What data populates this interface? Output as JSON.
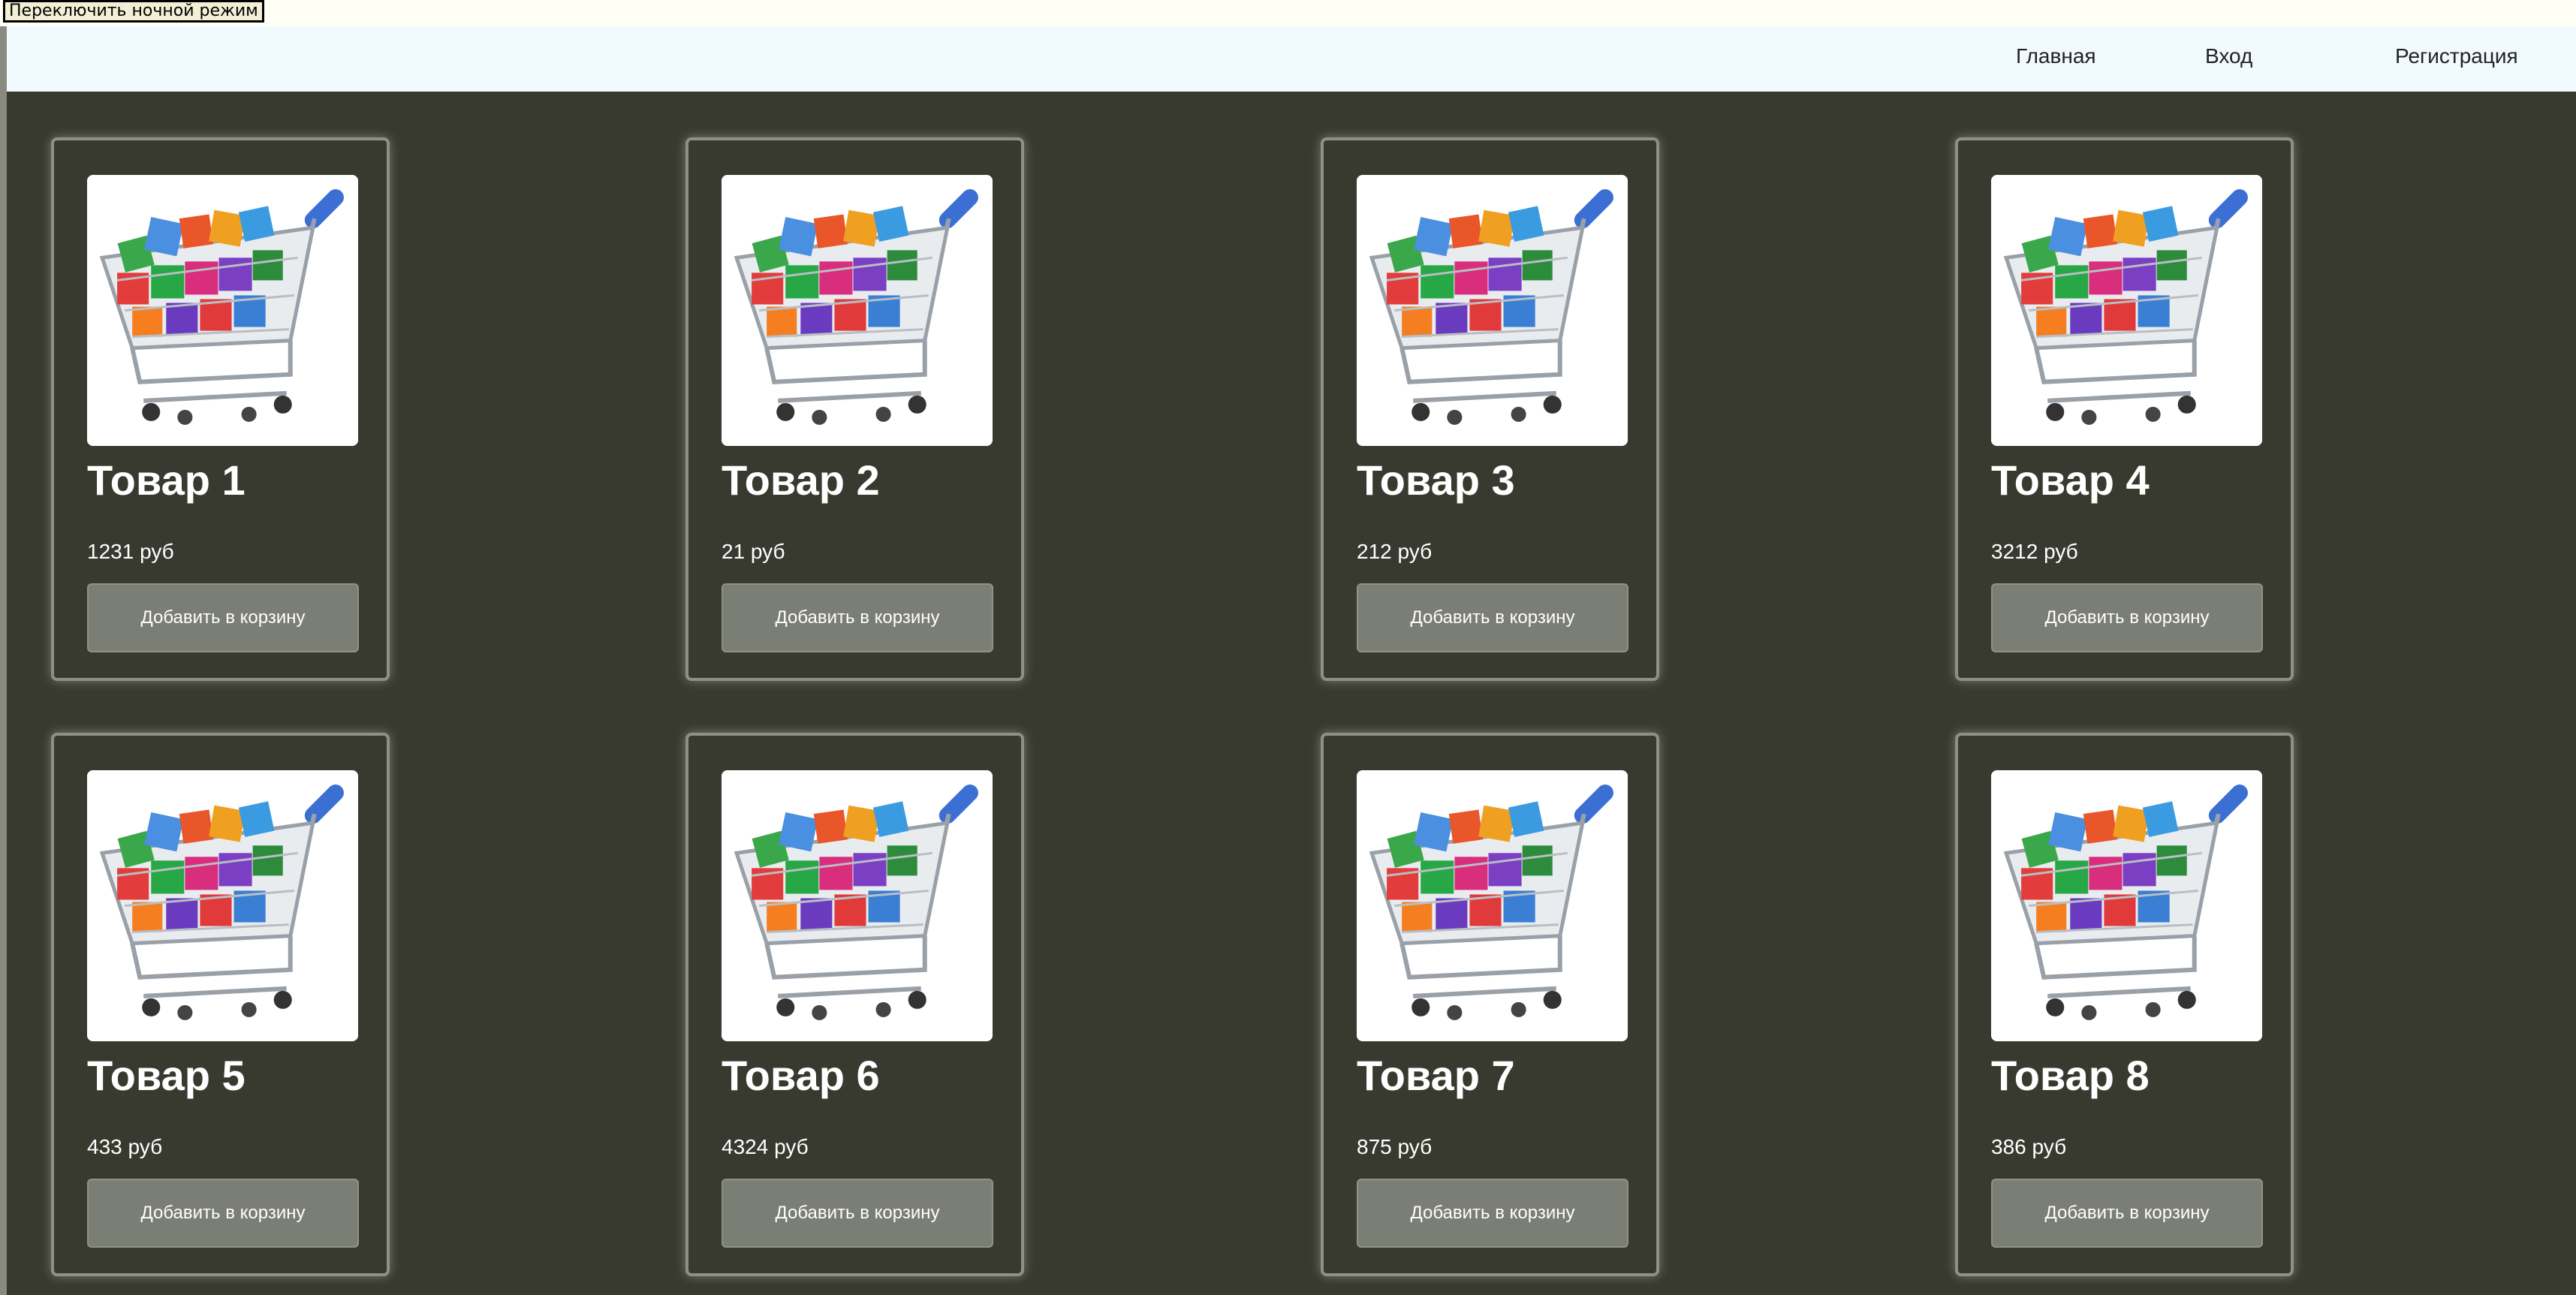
{
  "toggle": {
    "label": "Переключить ночной режим"
  },
  "nav": {
    "items": [
      {
        "label": "Главная"
      },
      {
        "label": "Вход"
      },
      {
        "label": "Регистрация"
      }
    ]
  },
  "products": [
    {
      "title": "Товар 1",
      "price": "1231 руб",
      "button": "Добавить в корзину",
      "image": "shopping-cart-image"
    },
    {
      "title": "Товар 2",
      "price": "21 руб",
      "button": "Добавить в корзину",
      "image": "shopping-cart-image"
    },
    {
      "title": "Товар 3",
      "price": "212 руб",
      "button": "Добавить в корзину",
      "image": "shopping-cart-image"
    },
    {
      "title": "Товар 4",
      "price": "3212 руб",
      "button": "Добавить в корзину",
      "image": "shopping-cart-image"
    },
    {
      "title": "Товар 5",
      "price": "433 руб",
      "button": "Добавить в корзину",
      "image": "shopping-cart-image"
    },
    {
      "title": "Товар 6",
      "price": "4324 руб",
      "button": "Добавить в корзину",
      "image": "shopping-cart-image"
    },
    {
      "title": "Товар 7",
      "price": "875 руб",
      "button": "Добавить в корзину",
      "image": "shopping-cart-image"
    },
    {
      "title": "Товар 8",
      "price": "386 руб",
      "button": "Добавить в корзину",
      "image": "shopping-cart-image"
    }
  ],
  "colors": {
    "page_background": "#393a2f",
    "navbar_background": "#f1fbff",
    "button_background": "#7b7e74",
    "card_border": "#8e9086"
  }
}
